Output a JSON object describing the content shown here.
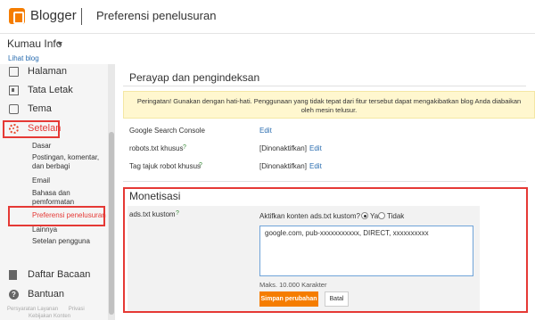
{
  "header": {
    "brand": "Blogger",
    "page_title": "Preferensi penelusuran"
  },
  "blog": {
    "name": "Kumau Info",
    "view_link": "Lihat blog"
  },
  "sidebar": {
    "items": [
      {
        "label": "Halaman",
        "icon": "pages-icon"
      },
      {
        "label": "Tata Letak",
        "icon": "layout-icon"
      },
      {
        "label": "Tema",
        "icon": "theme-icon"
      },
      {
        "label": "Setelan",
        "icon": "gear-icon",
        "active": true
      }
    ],
    "subitems": [
      "Dasar",
      "Postingan, komentar, dan berbagi",
      "Email",
      "Bahasa dan pemformatan",
      "Preferensi penelusuran",
      "Lainnya",
      "Setelan pengguna"
    ],
    "bottom_items": [
      {
        "label": "Daftar Bacaan",
        "icon": "bookmark-icon"
      },
      {
        "label": "Bantuan",
        "icon": "help-icon"
      }
    ],
    "footer": {
      "terms": "Persyaratan Layanan",
      "privacy": "Privasi",
      "content_policy": "Kebijakan Konten"
    }
  },
  "crawl": {
    "title": "Perayap dan pengindeksan",
    "warning": "Peringatan! Gunakan dengan hati-hati. Penggunaan yang tidak tepat dari fitur tersebut dapat mengakibatkan blog Anda diabaikan oleh mesin telusur.",
    "rows": [
      {
        "label": "Google Search Console",
        "help": "",
        "value": "",
        "edit": "Edit"
      },
      {
        "label": "robots.txt khusus",
        "help": "?",
        "value": "[Dinonaktifkan]",
        "edit": "Edit"
      },
      {
        "label": "Tag tajuk robot khusus",
        "help": "?",
        "value": "[Dinonaktifkan]",
        "edit": "Edit"
      }
    ]
  },
  "monetization": {
    "title": "Monetisasi",
    "label": "ads.txt kustom",
    "help": "?",
    "question": "Aktifkan konten ads.txt kustom?",
    "option_yes": "Ya",
    "option_no": "Tidak",
    "selected": "Ya",
    "content": "google.com, pub-xxxxxxxxxxx, DIRECT, xxxxxxxxxx",
    "max_chars": "Maks. 10.000 Karakter",
    "save_label": "Simpan perubahan",
    "cancel_label": "Batal"
  },
  "colors": {
    "accent": "#f57d00",
    "highlight": "#e53935",
    "link": "#2a6db0",
    "warning_bg": "#fff7cf"
  }
}
